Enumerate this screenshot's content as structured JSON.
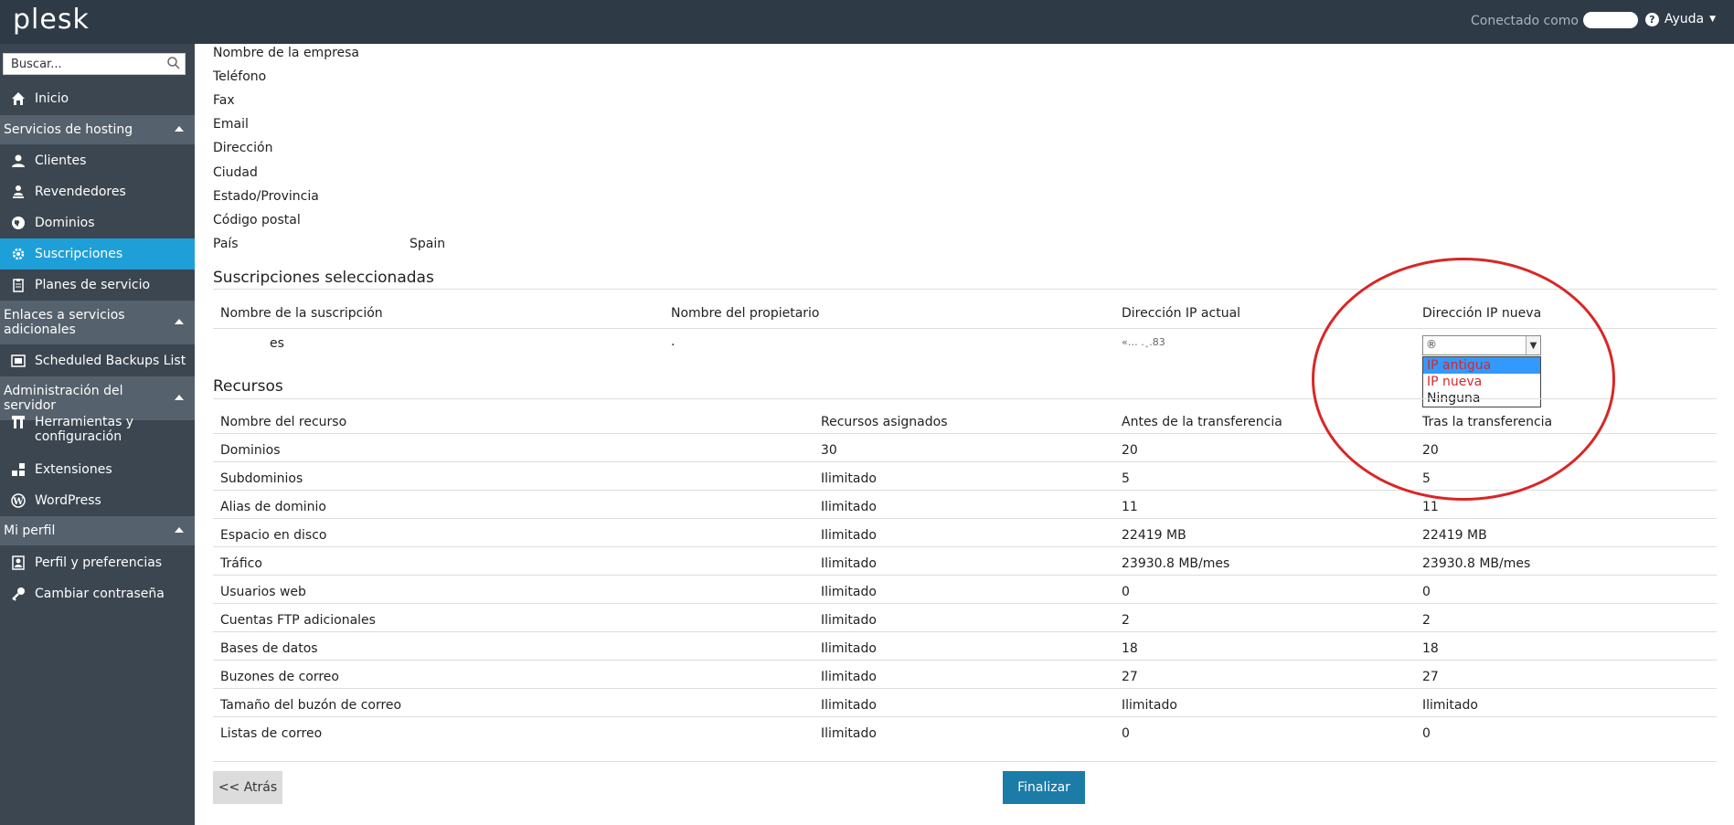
{
  "header": {
    "logo": "plesk",
    "connected_label": "Conectado como",
    "help_label": "Ayuda"
  },
  "sidebar": {
    "search_placeholder": "Buscar...",
    "home": "Inicio",
    "sections": [
      {
        "title": "Servicios de hosting",
        "items": [
          "Clientes",
          "Revendedores",
          "Dominios",
          "Suscripciones",
          "Planes de servicio"
        ]
      },
      {
        "title": "Enlaces a servicios adicionales",
        "items": [
          "Scheduled Backups List"
        ]
      },
      {
        "title": "Administración del servidor",
        "items": [
          "Herramientas y configuración",
          "Extensiones",
          "WordPress"
        ]
      },
      {
        "title": "Mi perfil",
        "items": [
          "Perfil y preferencias",
          "Cambiar contraseña"
        ]
      }
    ]
  },
  "contact": {
    "company_label": "Nombre de la empresa",
    "phone_label": "Teléfono",
    "fax_label": "Fax",
    "email_label": "Email",
    "address_label": "Dirección",
    "city_label": "Ciudad",
    "state_label": "Estado/Provincia",
    "zip_label": "Código postal",
    "country_label": "País",
    "country_value": "Spain"
  },
  "subscriptions": {
    "title": "Suscripciones seleccionadas",
    "headers": [
      "Nombre de la suscripción",
      "Nombre del propietario",
      "Dirección IP actual",
      "Dirección IP nueva"
    ],
    "row": {
      "name_fragment": "es",
      "owner_fragment": ".",
      "ip_fragment": "«… .¸.83",
      "select_value": "®"
    },
    "ip_options": [
      "IP antigua",
      "IP nueva",
      "Ninguna"
    ]
  },
  "resources": {
    "title": "Recursos",
    "headers": [
      "Nombre del recurso",
      "Recursos asignados",
      "Antes de la transferencia",
      "Tras la transferencia"
    ],
    "rows": [
      [
        "Dominios",
        "30",
        "20",
        "20"
      ],
      [
        "Subdominios",
        "Ilimitado",
        "5",
        "5"
      ],
      [
        "Alias de dominio",
        "Ilimitado",
        "11",
        "11"
      ],
      [
        "Espacio en disco",
        "Ilimitado",
        "22419 MB",
        "22419 MB"
      ],
      [
        "Tráfico",
        "Ilimitado",
        "23930.8 MB/mes",
        "23930.8 MB/mes"
      ],
      [
        "Usuarios web",
        "Ilimitado",
        "0",
        "0"
      ],
      [
        "Cuentas FTP adicionales",
        "Ilimitado",
        "2",
        "2"
      ],
      [
        "Bases de datos",
        "Ilimitado",
        "18",
        "18"
      ],
      [
        "Buzones de correo",
        "Ilimitado",
        "27",
        "27"
      ],
      [
        "Tamaño del buzón de correo",
        "Ilimitado",
        "Ilimitado",
        "Ilimitado"
      ],
      [
        "Listas de correo",
        "Ilimitado",
        "0",
        "0"
      ]
    ]
  },
  "buttons": {
    "back": "<< Atrás",
    "finish": "Finalizar"
  }
}
